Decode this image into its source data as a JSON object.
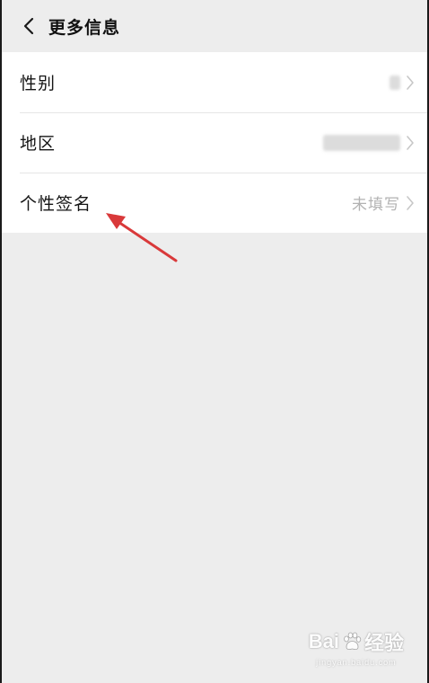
{
  "header": {
    "title": "更多信息",
    "back_icon": "chevron-left-icon"
  },
  "rows": [
    {
      "label": "性别",
      "value": "",
      "value_blurred": true,
      "chevron_icon": "chevron-right-icon"
    },
    {
      "label": "地区",
      "value": "",
      "value_blurred": true,
      "chevron_icon": "chevron-right-icon"
    },
    {
      "label": "个性签名",
      "value": "未填写",
      "value_blurred": false,
      "chevron_icon": "chevron-right-icon"
    }
  ],
  "annotation": {
    "icon": "red-arrow-icon",
    "color": "#d9393a"
  },
  "watermark": {
    "brand_left": "Bai",
    "paw_icon": "paw-icon",
    "brand_right": "经验",
    "domain": "jingyan.baidu.com"
  },
  "colors": {
    "background": "#ededed",
    "list_background": "#ffffff",
    "secondary_text": "#b2b2b2"
  }
}
